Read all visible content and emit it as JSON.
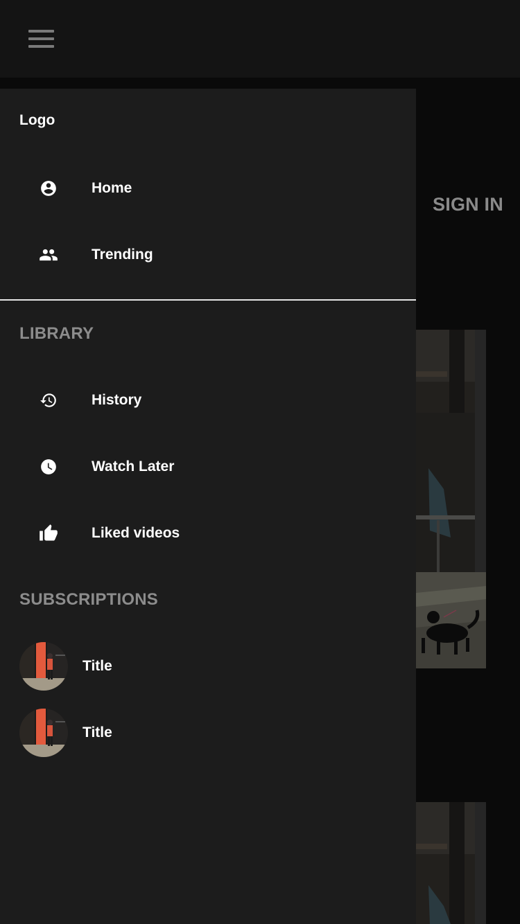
{
  "appbar": {
    "menu_icon": "menu-icon"
  },
  "background": {
    "signin_label": "SIGN IN"
  },
  "drawer": {
    "logo": "Logo",
    "main_items": [
      {
        "label": "Home",
        "icon": "account-circle-icon"
      },
      {
        "label": "Trending",
        "icon": "people-icon"
      }
    ],
    "library": {
      "title": "LIBRARY",
      "items": [
        {
          "label": "History",
          "icon": "history-icon"
        },
        {
          "label": "Watch Later",
          "icon": "clock-icon"
        },
        {
          "label": "Liked videos",
          "icon": "thumb-up-icon"
        }
      ]
    },
    "subscriptions": {
      "title": "SUBSCRIPTIONS",
      "items": [
        {
          "label": "Title"
        },
        {
          "label": "Title"
        }
      ]
    }
  },
  "colors": {
    "drawer_bg": "#1c1c1c",
    "appbar_bg": "#141414",
    "page_bg": "#0a0a0a",
    "section_title": "#8c8c8c",
    "text": "#ffffff"
  }
}
